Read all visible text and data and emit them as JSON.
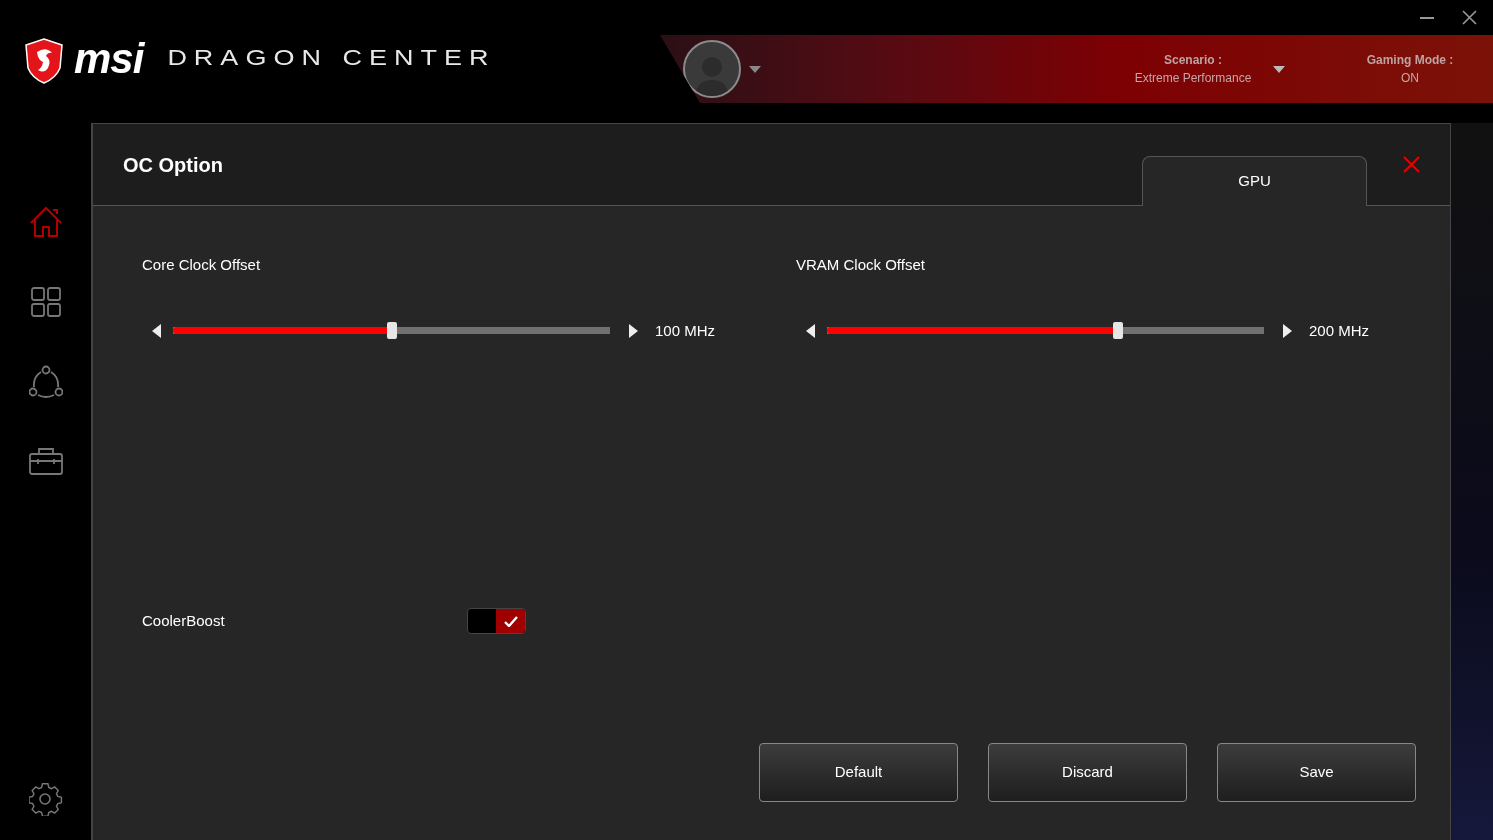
{
  "app": {
    "brand": "msi",
    "title": "DRAGON CENTER"
  },
  "header": {
    "scenario_label": "Scenario :",
    "scenario_value": "Extreme Performance",
    "gaming_mode_label": "Gaming Mode :",
    "gaming_mode_value": "ON"
  },
  "sidebar": {
    "items": [
      {
        "kind": "home",
        "selected": true
      },
      {
        "kind": "apps",
        "selected": false
      },
      {
        "kind": "network",
        "selected": false
      },
      {
        "kind": "toolbox",
        "selected": false
      }
    ]
  },
  "dialog": {
    "title": "OC Option",
    "tabs": [
      {
        "label": "GPU",
        "selected": true
      }
    ],
    "sliders": [
      {
        "label": "Core Clock Offset",
        "level": 0.5,
        "reading": "100 MHz"
      },
      {
        "label": "VRAM Clock Offset",
        "level": 0.665,
        "reading": "200 MHz"
      }
    ],
    "toggles": [
      {
        "label": "CoolerBoost",
        "on": true
      }
    ],
    "buttons": [
      "Default",
      "Discard",
      "Save"
    ]
  }
}
